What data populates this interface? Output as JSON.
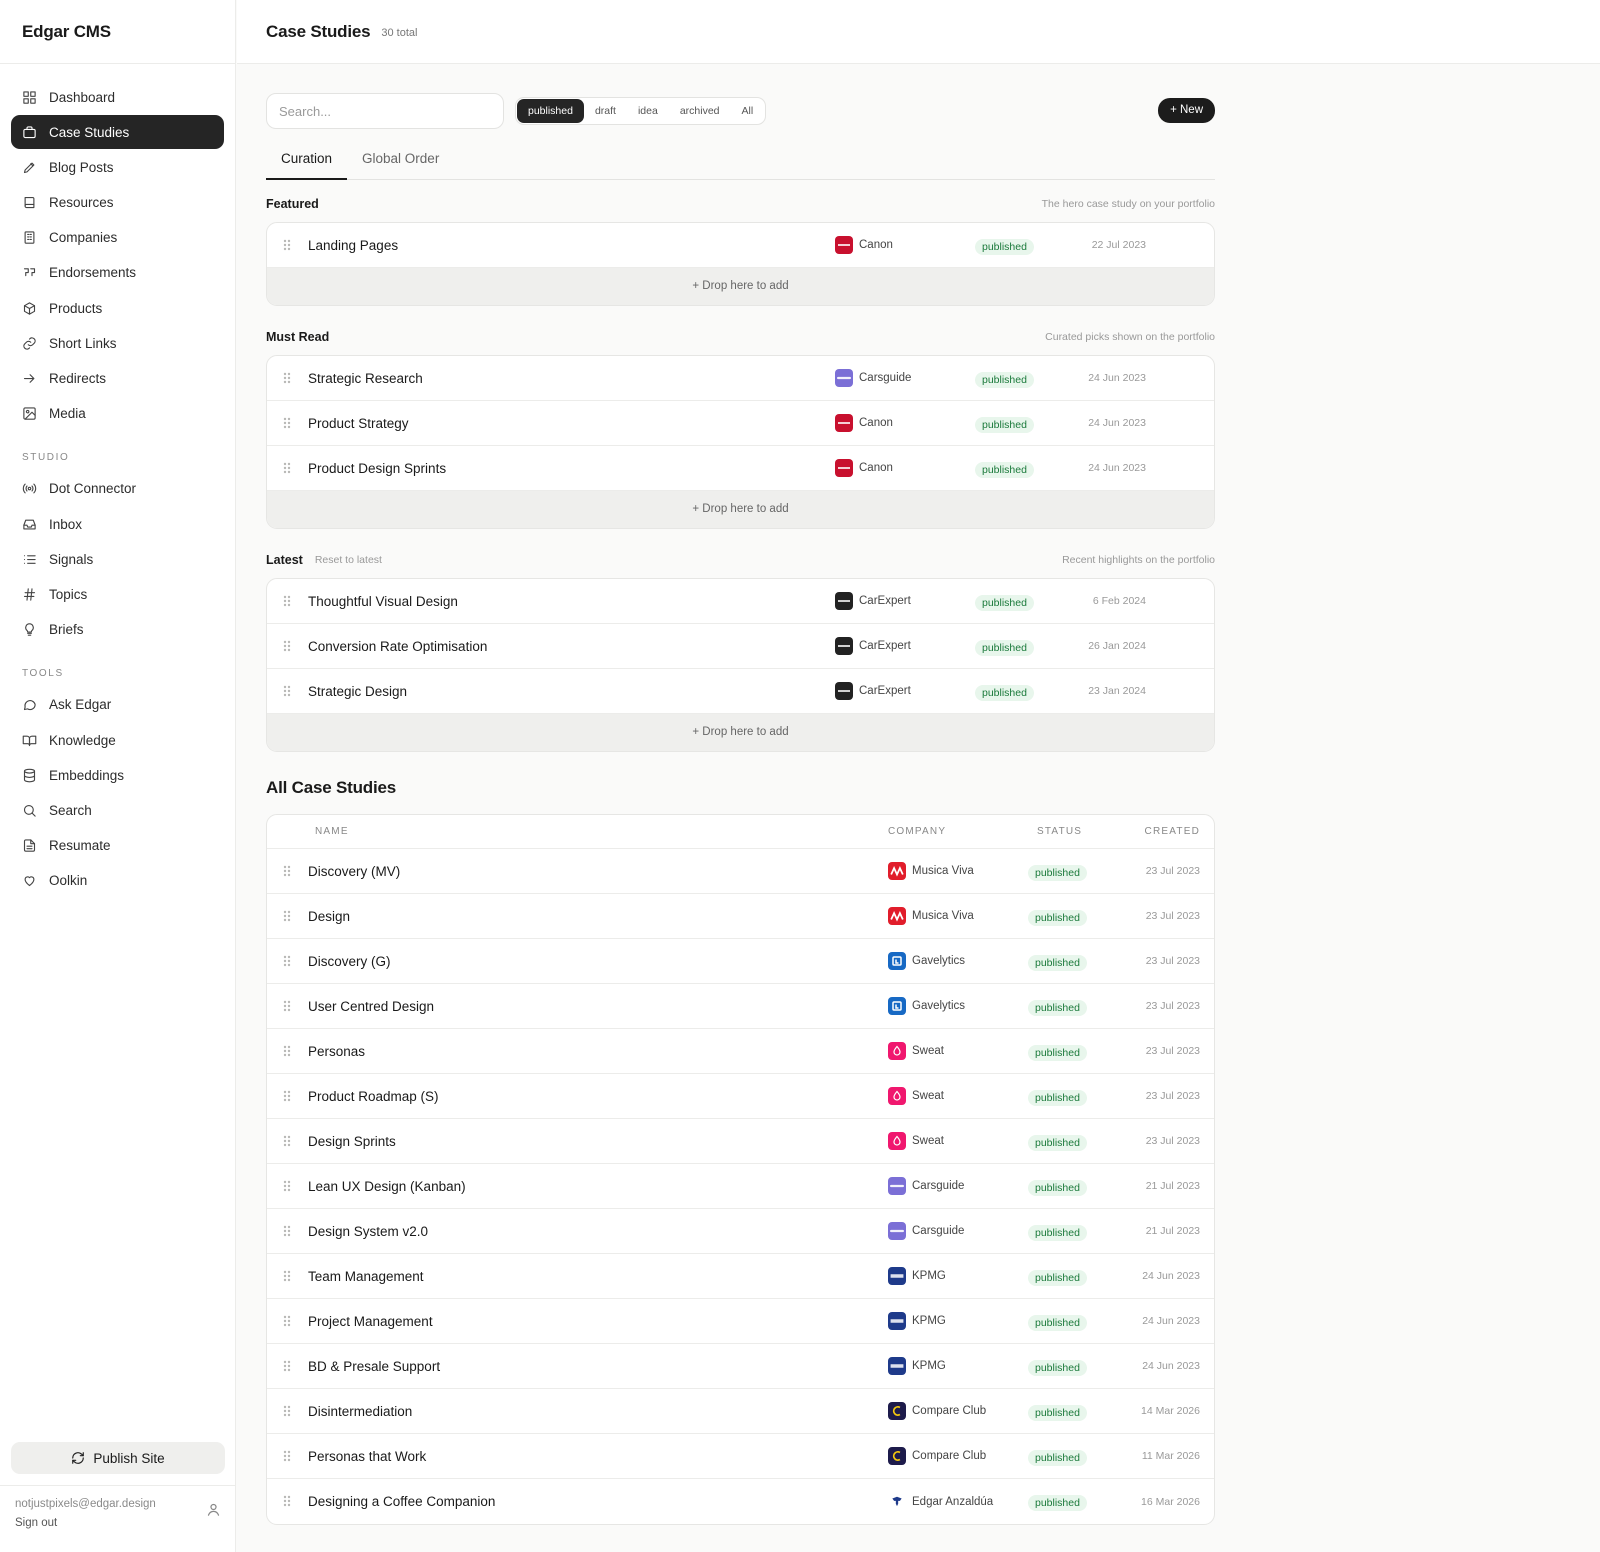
{
  "app": {
    "brand": "Edgar CMS"
  },
  "nav": {
    "main": [
      {
        "label": "Dashboard",
        "icon": "grid-icon",
        "active": false
      },
      {
        "label": "Case Studies",
        "icon": "briefcase-icon",
        "active": true
      },
      {
        "label": "Blog Posts",
        "icon": "pen-icon",
        "active": false
      },
      {
        "label": "Resources",
        "icon": "book-icon",
        "active": false
      },
      {
        "label": "Companies",
        "icon": "building-icon",
        "active": false
      },
      {
        "label": "Endorsements",
        "icon": "quote-icon",
        "active": false
      },
      {
        "label": "Products",
        "icon": "box-icon",
        "active": false
      },
      {
        "label": "Short Links",
        "icon": "link-icon",
        "active": false
      },
      {
        "label": "Redirects",
        "icon": "arrow-right-icon",
        "active": false
      },
      {
        "label": "Media",
        "icon": "image-icon",
        "active": false
      }
    ],
    "studio_label": "STUDIO",
    "studio": [
      {
        "label": "Dot Connector",
        "icon": "radio-icon"
      },
      {
        "label": "Inbox",
        "icon": "inbox-icon"
      },
      {
        "label": "Signals",
        "icon": "list-icon"
      },
      {
        "label": "Topics",
        "icon": "hash-icon"
      },
      {
        "label": "Briefs",
        "icon": "lightbulb-icon"
      }
    ],
    "tools_label": "TOOLS",
    "tools": [
      {
        "label": "Ask Edgar",
        "icon": "chat-icon"
      },
      {
        "label": "Knowledge",
        "icon": "open-book-icon"
      },
      {
        "label": "Embeddings",
        "icon": "database-icon"
      },
      {
        "label": "Search",
        "icon": "search-icon"
      },
      {
        "label": "Resumate",
        "icon": "document-icon"
      },
      {
        "label": "Oolkin",
        "icon": "heart-icon"
      }
    ],
    "publish_label": "Publish Site",
    "account": {
      "email": "notjustpixels@edgar.design",
      "signout": "Sign out"
    }
  },
  "header": {
    "title": "Case Studies",
    "count": "30 total"
  },
  "toolbar": {
    "search_placeholder": "Search...",
    "filters": [
      "published",
      "draft",
      "idea",
      "archived",
      "All"
    ],
    "active_filter": "published",
    "new_label": "+ New"
  },
  "tabs": [
    {
      "label": "Curation",
      "active": true
    },
    {
      "label": "Global Order",
      "active": false
    }
  ],
  "groups": [
    {
      "title": "Featured",
      "reset": "",
      "hint": "The hero case study on your portfolio",
      "rows": [
        {
          "name": "Landing Pages",
          "company": "Canon",
          "logo": "canon",
          "status": "published",
          "date": "22 Jul 2023"
        }
      ],
      "drop_label": "+ Drop here to add"
    },
    {
      "title": "Must Read",
      "reset": "",
      "hint": "Curated picks shown on the portfolio",
      "rows": [
        {
          "name": "Strategic Research",
          "company": "Carsguide",
          "logo": "carsguide",
          "status": "published",
          "date": "24 Jun 2023"
        },
        {
          "name": "Product Strategy",
          "company": "Canon",
          "logo": "canon",
          "status": "published",
          "date": "24 Jun 2023"
        },
        {
          "name": "Product Design Sprints",
          "company": "Canon",
          "logo": "canon",
          "status": "published",
          "date": "24 Jun 2023"
        }
      ],
      "drop_label": "+ Drop here to add"
    },
    {
      "title": "Latest",
      "reset": "Reset to latest",
      "hint": "Recent highlights on the portfolio",
      "rows": [
        {
          "name": "Thoughtful Visual Design",
          "company": "CarExpert",
          "logo": "carexpert",
          "status": "published",
          "date": "6 Feb 2024"
        },
        {
          "name": "Conversion Rate Optimisation",
          "company": "CarExpert",
          "logo": "carexpert",
          "status": "published",
          "date": "26 Jan 2024"
        },
        {
          "name": "Strategic Design",
          "company": "CarExpert",
          "logo": "carexpert",
          "status": "published",
          "date": "23 Jan 2024"
        }
      ],
      "drop_label": "+ Drop here to add"
    }
  ],
  "all": {
    "title": "All Case Studies",
    "columns": {
      "name": "NAME",
      "company": "COMPANY",
      "status": "STATUS",
      "created": "CREATED"
    },
    "rows": [
      {
        "name": "Discovery (MV)",
        "company": "Musica Viva",
        "logo": "musicaviva",
        "status": "published",
        "date": "23 Jul 2023"
      },
      {
        "name": "Design",
        "company": "Musica Viva",
        "logo": "musicaviva",
        "status": "published",
        "date": "23 Jul 2023"
      },
      {
        "name": "Discovery (G)",
        "company": "Gavelytics",
        "logo": "gavelytics",
        "status": "published",
        "date": "23 Jul 2023"
      },
      {
        "name": "User Centred Design",
        "company": "Gavelytics",
        "logo": "gavelytics",
        "status": "published",
        "date": "23 Jul 2023"
      },
      {
        "name": "Personas",
        "company": "Sweat",
        "logo": "sweat",
        "status": "published",
        "date": "23 Jul 2023"
      },
      {
        "name": "Product Roadmap (S)",
        "company": "Sweat",
        "logo": "sweat",
        "status": "published",
        "date": "23 Jul 2023"
      },
      {
        "name": "Design Sprints",
        "company": "Sweat",
        "logo": "sweat",
        "status": "published",
        "date": "23 Jul 2023"
      },
      {
        "name": "Lean UX Design (Kanban)",
        "company": "Carsguide",
        "logo": "carsguide",
        "status": "published",
        "date": "21 Jul 2023"
      },
      {
        "name": "Design System v2.0",
        "company": "Carsguide",
        "logo": "carsguide",
        "status": "published",
        "date": "21 Jul 2023"
      },
      {
        "name": "Team Management",
        "company": "KPMG",
        "logo": "kpmg",
        "status": "published",
        "date": "24 Jun 2023"
      },
      {
        "name": "Project Management",
        "company": "KPMG",
        "logo": "kpmg",
        "status": "published",
        "date": "24 Jun 2023"
      },
      {
        "name": "BD & Presale Support",
        "company": "KPMG",
        "logo": "kpmg",
        "status": "published",
        "date": "24 Jun 2023"
      },
      {
        "name": "Disintermediation",
        "company": "Compare Club",
        "logo": "compareclub",
        "status": "published",
        "date": "14 Mar 2026"
      },
      {
        "name": "Personas that Work",
        "company": "Compare Club",
        "logo": "compareclub",
        "status": "published",
        "date": "11 Mar 2026"
      },
      {
        "name": "Designing a Coffee Companion",
        "company": "Edgar Anzaldúa",
        "logo": "edgar",
        "status": "published",
        "date": "16 Mar 2026"
      }
    ]
  },
  "logo_colors": {
    "canon": "#c8102e",
    "carsguide": "#7b6fd6",
    "carexpert": "#222222",
    "musicaviva": "#e11d2b",
    "gavelytics": "#1769c4",
    "sweat": "#f0176e",
    "kpmg": "#1e3a8a",
    "compareclub": "#1d1b4b",
    "edgar": "#ffffff"
  },
  "status_colors": {
    "published_text": "#1b7a3b",
    "published_bg": "#e8f6ec"
  }
}
